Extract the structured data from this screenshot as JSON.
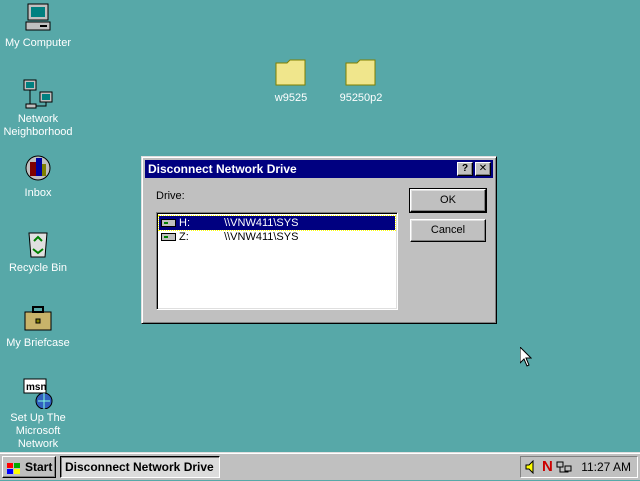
{
  "desktop": {
    "icons": [
      {
        "label": "My Computer",
        "icon": "computer-icon"
      },
      {
        "label": "Network Neighborhood",
        "icon": "network-icon"
      },
      {
        "label": "Inbox",
        "icon": "inbox-icon"
      },
      {
        "label": "Recycle Bin",
        "icon": "recycle-bin-icon"
      },
      {
        "label": "My Briefcase",
        "icon": "briefcase-icon"
      },
      {
        "label": "Set Up The Microsoft Network",
        "icon": "msn-icon"
      }
    ],
    "folders": [
      {
        "label": "w9525"
      },
      {
        "label": "95250p2"
      }
    ]
  },
  "dialog": {
    "title": "Disconnect Network Drive",
    "help_glyph": "?",
    "close_glyph": "✕",
    "drive_label": "Drive:",
    "ok_label": "OK",
    "cancel_label": "Cancel",
    "drives": [
      {
        "letter": "H:",
        "path": "\\\\VNW411\\SYS",
        "selected": true
      },
      {
        "letter": "Z:",
        "path": "\\\\VNW411\\SYS",
        "selected": false
      }
    ]
  },
  "taskbar": {
    "start_label": "Start",
    "task_label": "Disconnect Network Drive",
    "clock": "11:27 AM"
  },
  "colors": {
    "desktop": "#57a8a8",
    "titlebar": "#000080",
    "face": "#c0c0c0"
  }
}
